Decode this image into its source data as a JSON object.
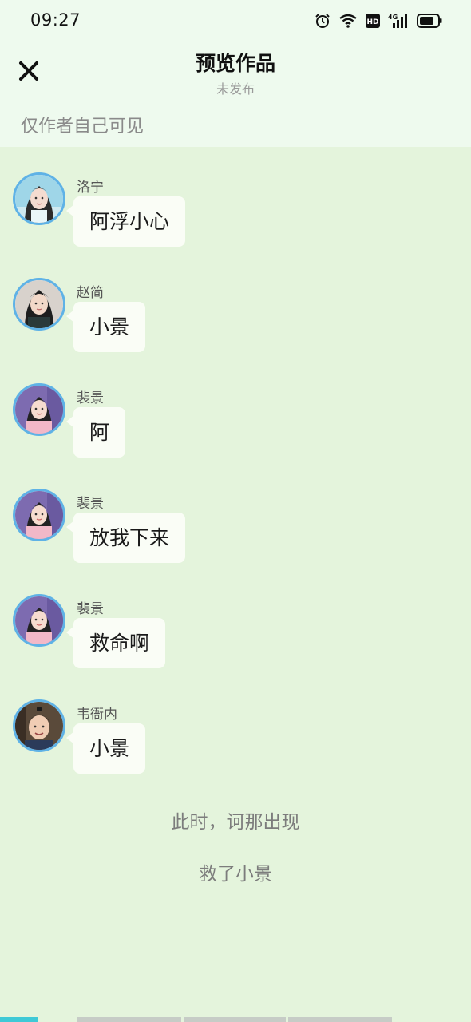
{
  "status_bar": {
    "time": "09:27",
    "hd_label": "HD",
    "network_label": "4G",
    "icons": [
      "alarm-icon",
      "wifi-icon",
      "hd-icon",
      "signal-icon",
      "battery-icon"
    ]
  },
  "header": {
    "close_icon": "close-icon",
    "title": "预览作品",
    "subtitle": "未发布"
  },
  "visibility_note": "仅作者自己可见",
  "messages": [
    {
      "sender": "洛宁",
      "text": "阿浮小心",
      "avatar": "avatar-luoning"
    },
    {
      "sender": "赵简",
      "text": "小景",
      "avatar": "avatar-zhaojian"
    },
    {
      "sender": "裴景",
      "text": "阿",
      "avatar": "avatar-peijing"
    },
    {
      "sender": "裴景",
      "text": "放我下来",
      "avatar": "avatar-peijing"
    },
    {
      "sender": "裴景",
      "text": "救命啊",
      "avatar": "avatar-peijing"
    },
    {
      "sender": "韦衙内",
      "text": "小景",
      "avatar": "avatar-weiyanei"
    }
  ],
  "narration": [
    "此时，诃那出现",
    "救了小景"
  ],
  "colors": {
    "background": "#e4f4dc",
    "header_background": "#eefaee",
    "bubble": "#fafdf6",
    "avatar_border": "#5fb2e6",
    "bottom_accent": "#3fc9d6"
  }
}
